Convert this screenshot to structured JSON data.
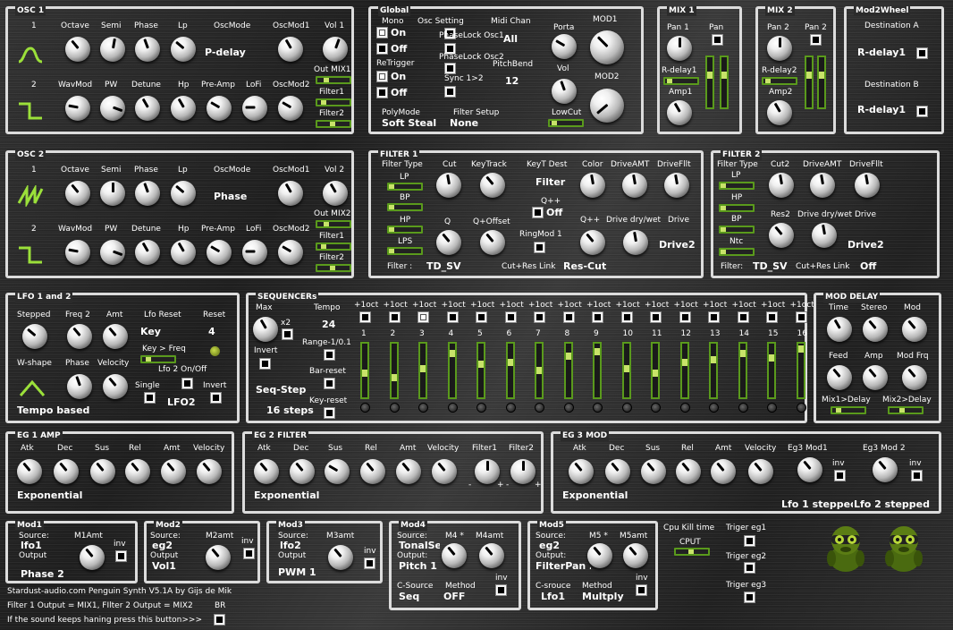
{
  "osc1": {
    "title": "OSC 1",
    "n1": "1",
    "n2": "2",
    "octave": "Octave",
    "semi": "Semi",
    "phase": "Phase",
    "lp": "Lp",
    "oscmode": "OscMode",
    "oscmode_val": "P-delay",
    "oscmod1": "OscMod1",
    "vol1": "Vol 1",
    "wavmod": "WavMod",
    "pw": "PW",
    "detune": "Detune",
    "hp": "Hp",
    "preamp": "Pre-Amp",
    "lofi": "LoFi",
    "oscmod2": "OscMod2",
    "outmix": "Out MIX1",
    "filter1": "Filter1",
    "filter2": "Filter2"
  },
  "osc2": {
    "title": "OSC 2",
    "n1": "1",
    "n2": "2",
    "octave": "Octave",
    "semi": "Semi",
    "phase": "Phase",
    "lp": "Lp",
    "oscmode": "OscMode",
    "oscmode_val": "Phase",
    "oscmod1": "OscMod1",
    "vol2": "Vol 2",
    "wavmod": "WavMod",
    "pw": "PW",
    "detune": "Detune",
    "hp": "Hp",
    "preamp": "Pre-Amp",
    "lofi": "LoFi",
    "oscmod2": "OscMod2",
    "outmix": "Out MIX2",
    "filter1": "Filter1",
    "filter2": "Filter2"
  },
  "global": {
    "title": "Global",
    "mono": "Mono",
    "on": "On",
    "off": "Off",
    "retrigger": "ReTrigger",
    "on2": "On",
    "off2": "Off",
    "osc_setting": "Osc Setting",
    "phaselock1": "PhaseLock Osc1",
    "phaselock2": "PhaseLock Osc2",
    "sync": "Sync 1>2",
    "midi_chan": "Midi Chan",
    "midi_val": "All",
    "pitchbend": "PitchBend",
    "pitchbend_val": "12",
    "porta": "Porta",
    "vol": "Vol",
    "mod1": "MOD1",
    "mod2": "MOD2",
    "polymode": "PolyMode",
    "polymode_val": "Soft Steal",
    "filter_setup": "Filter Setup",
    "filter_setup_val": "None",
    "lowcut": "LowCut"
  },
  "mix1": {
    "title": "MIX 1",
    "pan1": "Pan 1",
    "pan": "Pan",
    "rdelay": "R-delay1",
    "amp": "Amp1"
  },
  "mix2": {
    "title": "MIX 2",
    "pan2": "Pan 2",
    "pan2b": "Pan 2",
    "rdelay": "R-delay2",
    "amp": "Amp2"
  },
  "mod2wheel": {
    "title": "Mod2Wheel",
    "destA": "Destination A",
    "destA_val": "R-delay1",
    "destB": "Destination B",
    "destB_val": "R-delay1"
  },
  "filter1": {
    "title": "FILTER 1",
    "ftype": "Filter Type",
    "lp": "LP",
    "bp": "BP",
    "hp": "HP",
    "lps": "LPS",
    "filter_lbl": "Filter :",
    "filter_val": "TD_SV",
    "cut": "Cut",
    "q": "Q",
    "keytrack": "KeyTrack",
    "qoffset": "Q+Offset",
    "keyt_dest": "KeyT Dest",
    "keyt_val": "Filter",
    "qpp": "Q++",
    "qpp_val": "Off",
    "ringmod": "RingMod 1",
    "cutres": "Cut+Res Link",
    "cutres_val": "Res-Cut",
    "color": "Color",
    "driveamt": "DriveAMT",
    "driveflt": "DriveFllt",
    "qpp2": "Q++",
    "drivedw": "Drive dry/wet",
    "drive": "Drive",
    "drive_val": "Drive2"
  },
  "filter2": {
    "title": "FILTER 2",
    "ftype": "Filter Type",
    "lp": "LP",
    "hp": "HP",
    "bp": "BP",
    "ntc": "Ntc",
    "filter_lbl": "Filter:",
    "filter_val": "TD_SV",
    "cut2": "Cut2",
    "driveamt": "DriveAMT",
    "driveflt": "DriveFllt",
    "res2": "Res2",
    "drivedw": "Drive dry/wet",
    "drive": "Drive",
    "drive_val": "Drive2",
    "cutres": "Cut+Res Link",
    "cutres_val": "Off"
  },
  "lfo": {
    "title": "LFO 1 and 2",
    "stepped": "Stepped",
    "freq2": "Freq 2",
    "amt": "Amt",
    "lforeset": "Lfo Reset",
    "reset": "Reset",
    "key": "Key",
    "reset_val": "4",
    "keyfreq": "Key > Freq",
    "lfo2onoff": "Lfo 2 On/Off",
    "wshape": "W-shape",
    "phase": "Phase",
    "velocity": "Velocity",
    "single": "Single",
    "invert": "Invert",
    "lfo2": "LFO2",
    "tempo": "Tempo based"
  },
  "seq": {
    "title": "SEQUENCERs",
    "max": "Max",
    "x2": "x2",
    "invert": "Invert",
    "tempo": "Tempo",
    "tempo_val": "24",
    "range": "Range-1/0.1",
    "barreset": "Bar-reset",
    "seqstep": "Seq-Step",
    "keyreset": "Key-reset",
    "steps": "16 steps",
    "oct": "+1oct",
    "nums": [
      "1",
      "2",
      "3",
      "4",
      "5",
      "6",
      "7",
      "8",
      "9",
      "10",
      "11",
      "12",
      "13",
      "14",
      "15",
      "16"
    ],
    "levels": [
      0.6,
      0.7,
      0.5,
      0.15,
      0.4,
      0.35,
      0.55,
      0.2,
      0.1,
      0.5,
      0.6,
      0.35,
      0.3,
      0.15,
      0.25,
      0.05
    ]
  },
  "moddelay": {
    "title": "MOD DELAY",
    "time": "Time",
    "stereo": "Stereo",
    "mod": "Mod",
    "feed": "Feed",
    "amp": "Amp",
    "modfrq": "Mod Frq",
    "mix1": "Mix1>Delay",
    "mix2": "Mix2>Delay"
  },
  "eg1": {
    "title": "EG 1 AMP",
    "atk": "Atk",
    "dec": "Dec",
    "sus": "Sus",
    "rel": "Rel",
    "amt": "Amt",
    "velocity": "Velocity",
    "curve": "Exponential"
  },
  "eg2": {
    "title": "EG 2 FILTER",
    "atk": "Atk",
    "dec": "Dec",
    "sus": "Sus",
    "rel": "Rel",
    "amt": "Amt",
    "velocity": "Velocity",
    "filter1": "Filter1",
    "filter2": "Filter2",
    "curve": "Exponential",
    "minus": "-",
    "plus": "+"
  },
  "eg3": {
    "title": "EG 3 MOD",
    "atk": "Atk",
    "dec": "Dec",
    "sus": "Sus",
    "rel": "Rel",
    "amt": "Amt",
    "velocity": "Velocity",
    "mod1": "Eg3 Mod1",
    "mod2": "Eg3 Mod 2",
    "inv": "inv",
    "inv2": "inv",
    "curve": "Exponential",
    "lfo1": "Lfo 1 stepped",
    "lfo2": "Lfo 2 stepped"
  },
  "mod1": {
    "title": "Mod1",
    "source": "Source:",
    "source_val": "lfo1",
    "output": "Output",
    "output_val": "Phase 2",
    "amt": "M1Amt",
    "inv": "inv"
  },
  "mod2": {
    "title": "Mod2",
    "source": "Source:",
    "source_val": "eg2",
    "output": "Output",
    "output_val": "Vol1",
    "amt": "M2amt",
    "inv": "inv"
  },
  "mod3": {
    "title": "Mod3",
    "source": "Source:",
    "source_val": "lfo2",
    "output": "Output",
    "output_val": "PWM 1",
    "amt": "M3amt",
    "inv": "inv"
  },
  "mod4": {
    "title": "Mod4",
    "source": "Source:",
    "source_val": "TonalSe",
    "output": "Output:",
    "output_val": "Pitch 1",
    "m4": "M4 *",
    "amt": "M4amt",
    "csource": "C-Source",
    "csource_val": "Seq",
    "method": "Method",
    "method_val": "OFF",
    "inv": "inv"
  },
  "mod5": {
    "title": "Mod5",
    "source": "Source:",
    "source_val": "eg2",
    "output": "Output:",
    "output_val": "FilterPan 2",
    "m5": "M5 *",
    "amt": "M5amt",
    "csource": "C-srouce",
    "csource_val": "Lfo1",
    "method": "Method",
    "method_val": "Multply",
    "inv": "inv"
  },
  "cpu": {
    "label": "Cpu Kill time",
    "cput": "CPUT"
  },
  "trig": {
    "eg1": "Triger eg1",
    "eg2": "Triger eg2",
    "eg3": "Triger eg3"
  },
  "footer": {
    "credit": "Stardust-audio.com Penguin Synth V5.1A by Gijs de Mik",
    "routing": "Filter 1 Output = MIX1, FIlter 2 Output = MIX2",
    "br": "BR",
    "hang": "If the sound keeps haning press this button>>>"
  },
  "colors": {
    "accent": "#5a9a1c",
    "slider_fill": "#c8e36a",
    "border": "#dcdcdc"
  }
}
